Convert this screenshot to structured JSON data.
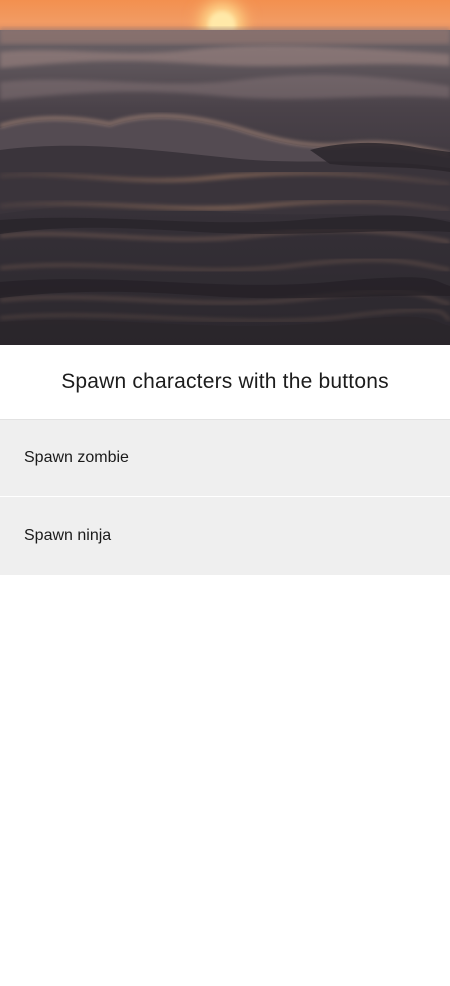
{
  "header": {
    "image": "ocean-waves-at-sunset-photo"
  },
  "title": "Spawn characters with the buttons",
  "buttons": [
    {
      "label": "Spawn zombie"
    },
    {
      "label": "Spawn ninja"
    }
  ],
  "colors": {
    "button_background": "#efefef",
    "divider": "#e2e2e2",
    "text": "#1a1a1a",
    "sky_orange": "#f08a48",
    "sun": "#ffe7a0",
    "water_dark": "#2d2a30"
  }
}
